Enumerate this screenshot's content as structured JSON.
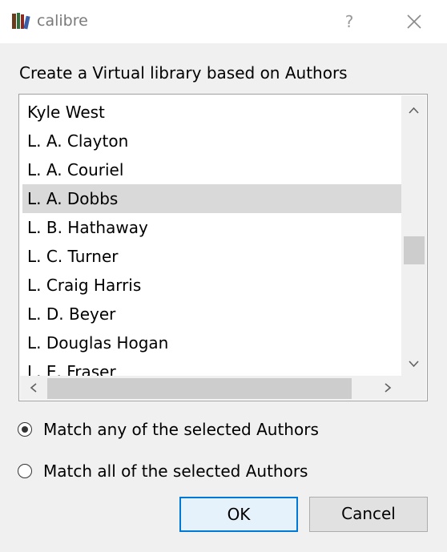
{
  "window": {
    "title": "calibre",
    "help_label": "?"
  },
  "prompt": "Create a Virtual library based on Authors",
  "authors": [
    "Kyle West",
    "L. A. Clayton",
    "L. A. Couriel",
    "L. A. Dobbs",
    "L. B. Hathaway",
    "L. C. Turner",
    "L. Craig Harris",
    "L. D. Beyer",
    "L. Douglas Hogan",
    "L. E. Fraser"
  ],
  "selected_author": "L. A. Dobbs",
  "options": {
    "match_any": "Match any of the selected Authors",
    "match_all": "Match all of the selected Authors",
    "selected": "match_any"
  },
  "buttons": {
    "ok": "OK",
    "cancel": "Cancel"
  },
  "icons": {
    "app": "calibre-books-icon",
    "close": "close-icon"
  },
  "colors": {
    "selection": "#d9d9d9",
    "focus_border": "#0078d7"
  }
}
